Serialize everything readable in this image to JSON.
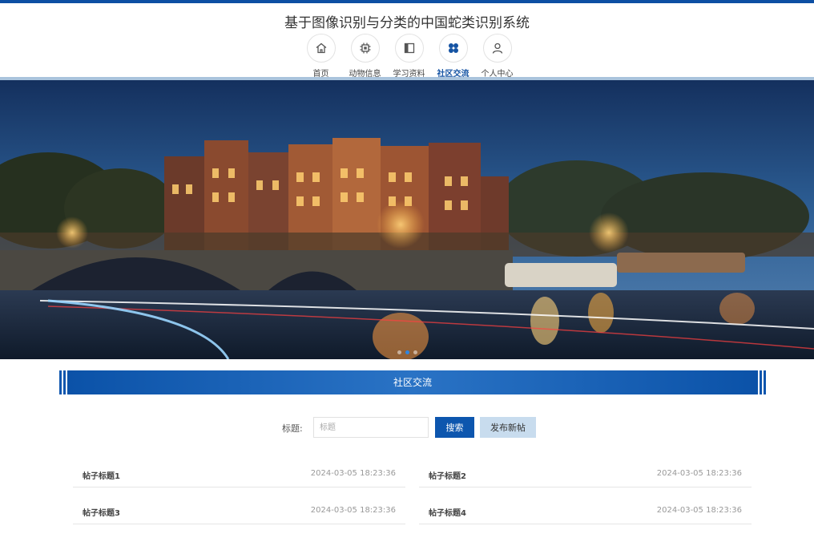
{
  "header": {
    "site_title": "基于图像识别与分类的中国蛇类识别系统"
  },
  "nav": {
    "items": [
      {
        "label": "首页",
        "icon": "home-icon",
        "active": false
      },
      {
        "label": "动物信息",
        "icon": "chip-icon",
        "active": false
      },
      {
        "label": "学习资料",
        "icon": "panel-icon",
        "active": false
      },
      {
        "label": "社区交流",
        "icon": "grid-clover-icon",
        "active": true
      },
      {
        "label": "个人中心",
        "icon": "user-icon",
        "active": false
      }
    ]
  },
  "carousel": {
    "slide_count": 3,
    "active_index": 1
  },
  "section": {
    "title": "社区交流"
  },
  "search": {
    "label": "标题:",
    "placeholder": "标题",
    "value": "",
    "search_button": "搜索",
    "post_button": "发布新帖"
  },
  "posts": [
    {
      "title": "帖子标题1",
      "time": "2024-03-05 18:23:36"
    },
    {
      "title": "帖子标题2",
      "time": "2024-03-05 18:23:36"
    },
    {
      "title": "帖子标题3",
      "time": "2024-03-05 18:23:36"
    },
    {
      "title": "帖子标题4",
      "time": "2024-03-05 18:23:36"
    }
  ],
  "colors": {
    "primary": "#0d56ae",
    "accent_light": "#c8dcee"
  }
}
